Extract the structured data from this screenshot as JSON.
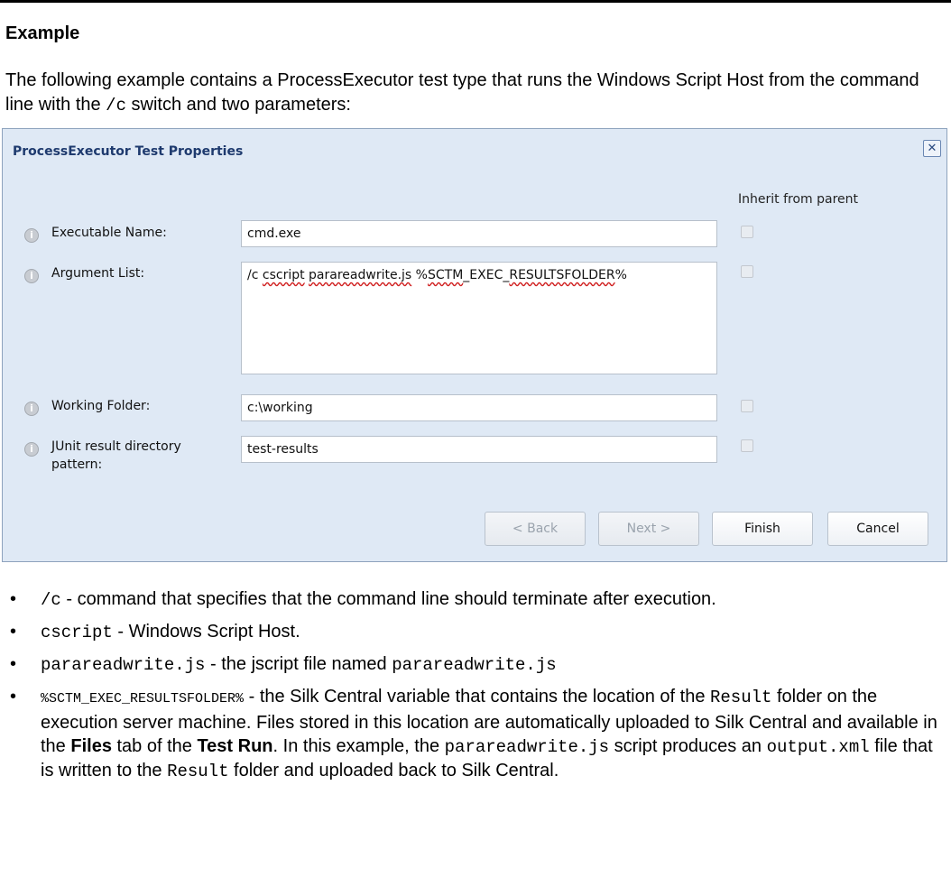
{
  "heading": "Example",
  "intro": {
    "before": "The following example contains a ProcessExecutor test type that runs the Windows Script Host from the command line with the ",
    "code": "/c",
    "after": " switch and two parameters:"
  },
  "dialog": {
    "title": "ProcessExecutor Test Properties",
    "close_glyph": "✕",
    "inherit_header": "Inherit from parent",
    "fields": [
      {
        "label": "Executable Name:",
        "value": "cmd.exe",
        "inherit": false
      },
      {
        "label": "Argument List:",
        "value_parts": [
          "/c ",
          "cscript",
          " ",
          "parareadwrite.js",
          " %",
          "SCTM",
          "_EXEC_",
          "RESULTSFOLDER",
          "%"
        ],
        "inherit": false
      },
      {
        "label": "Working Folder:",
        "value": "c:\\working",
        "inherit": false
      },
      {
        "label": "JUnit result directory pattern:",
        "value": "test-results",
        "inherit": false
      }
    ],
    "buttons": {
      "back": "< Back",
      "next": "Next >",
      "finish": "Finish",
      "cancel": "Cancel"
    },
    "icon_glyph": "i"
  },
  "bullets": [
    {
      "code": "/c",
      "text": " - command that specifies that the command line should terminate after execution."
    },
    {
      "code": "cscript",
      "text": " - Windows Script Host."
    },
    {
      "code": "parareadwrite.js",
      "text": " - the jscript file named ",
      "code2": "parareadwrite.js"
    },
    {
      "code": "%SCTM_EXEC_RESULTSFOLDER%",
      "t1": " - the Silk Central variable that contains the location of the ",
      "c1": "Result",
      "t2": " folder on the execution server machine. Files stored in this location are automatically uploaded to Silk Central and available in the ",
      "b1": "Files",
      "t3": " tab of the ",
      "b2": "Test Run",
      "t4": ". In this example, the ",
      "c2": "parareadwrite.js",
      "t5": " script produces an ",
      "c3": "output.xml",
      "t6": " file that is written to the ",
      "c4": "Result",
      "t7": " folder and uploaded back to Silk Central."
    }
  ],
  "bullet_glyph": "•"
}
